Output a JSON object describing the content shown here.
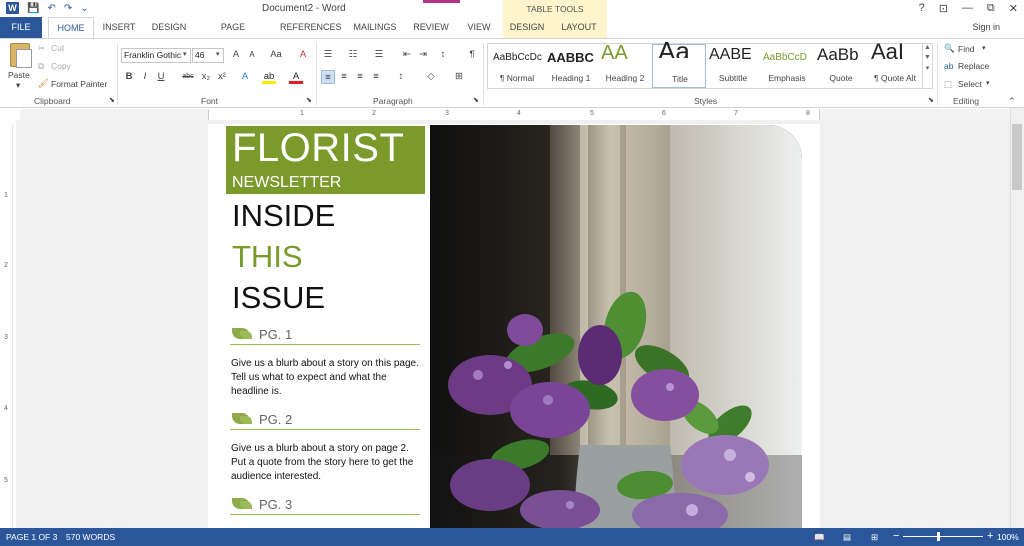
{
  "titlebar": {
    "doc_title": "Document2 - Word",
    "context_group": "TABLE TOOLS",
    "help": "?",
    "controls": [
      "⊡",
      "—",
      "⧉",
      "✕"
    ]
  },
  "tabs": {
    "file": "FILE",
    "items": [
      "HOME",
      "INSERT",
      "DESIGN",
      "PAGE LAYOUT",
      "REFERENCES",
      "MAILINGS",
      "REVIEW",
      "VIEW"
    ],
    "context": [
      "DESIGN",
      "LAYOUT"
    ],
    "sign_in": "Sign in"
  },
  "clipboard": {
    "paste": "Paste",
    "cut": "Cut",
    "copy": "Copy",
    "format_painter": "Format Painter",
    "label": "Clipboard"
  },
  "font": {
    "name": "Franklin Gothic",
    "size": "46",
    "label": "Font"
  },
  "paragraph": {
    "label": "Paragraph"
  },
  "styles": {
    "label": "Styles",
    "items": [
      {
        "sample": "AaBbCcDc",
        "name": "¶ Normal"
      },
      {
        "sample": "AABBC",
        "name": "Heading 1"
      },
      {
        "sample": "AA",
        "name": "Heading 2"
      },
      {
        "sample": "Aa",
        "name": "Title"
      },
      {
        "sample": "AABE",
        "name": "Subtitle"
      },
      {
        "sample": "AaBbCcD",
        "name": "Emphasis"
      },
      {
        "sample": "AaBb",
        "name": "Quote"
      },
      {
        "sample": "AaI",
        "name": "¶ Quote Alt"
      }
    ]
  },
  "editing": {
    "find": "Find",
    "replace": "Replace",
    "select": "Select",
    "label": "Editing"
  },
  "ruler": {
    "numbers": [
      "1",
      "2",
      "3",
      "4",
      "5",
      "6",
      "7",
      "8"
    ],
    "vnumbers": [
      "1",
      "2",
      "3",
      "4",
      "5"
    ]
  },
  "document": {
    "title": "FLORIST",
    "subtitle": "NEWSLETTER",
    "inside": [
      "INSIDE",
      "THIS",
      "ISSUE"
    ],
    "sections": [
      {
        "label": "PG. 1",
        "blurb": "Give us a blurb about a story on this page.  Tell us what to expect and what the headline is."
      },
      {
        "label": "PG. 2",
        "blurb": "Give us a blurb about a story on page 2. Put a quote from the story here to get the audience interested."
      },
      {
        "label": "PG. 3",
        "blurb": ""
      }
    ]
  },
  "statusbar": {
    "page": "PAGE 1 OF 3",
    "words": "570 WORDS",
    "zoom": "100%"
  },
  "colors": {
    "accent": "#2b579a",
    "newsletter_green": "#7a9b2b"
  }
}
